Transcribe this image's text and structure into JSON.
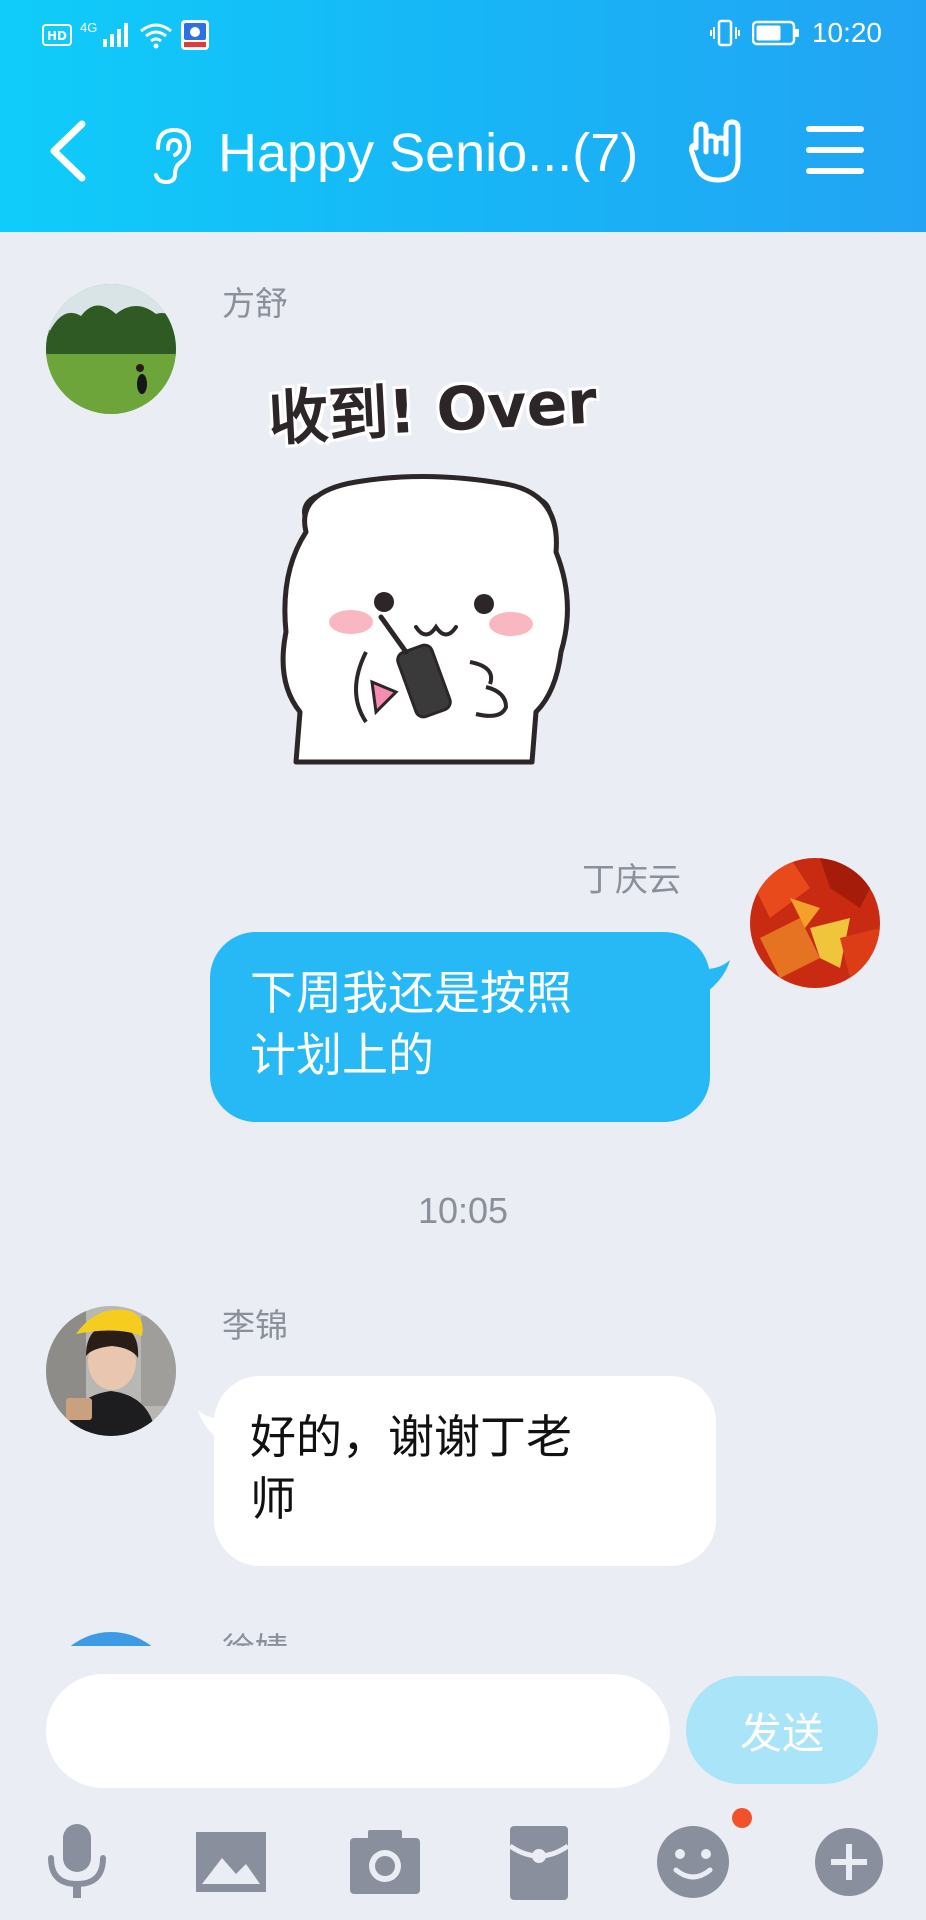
{
  "status_bar": {
    "network_label": "4G",
    "time": "10:20"
  },
  "header": {
    "title": "Happy Senio...(7)"
  },
  "messages": [
    {
      "sender": "方舒",
      "kind": "sticker",
      "sticker_text": "收到! Over"
    },
    {
      "sender": "丁庆云",
      "kind": "text",
      "outgoing": true,
      "lines": [
        "下周我还是按照",
        "计划上的"
      ]
    },
    {
      "kind": "timestamp",
      "time": "10:05"
    },
    {
      "sender": "李锦",
      "kind": "text",
      "outgoing": false,
      "lines": [
        "好的，谢谢丁老",
        "师"
      ]
    },
    {
      "sender": "徐婧",
      "kind": "partial"
    }
  ],
  "input": {
    "value": "",
    "send_label": "发送"
  },
  "toolbar": {
    "icons": [
      "microphone-icon",
      "image-icon",
      "camera-icon",
      "red-packet-icon",
      "emoji-icon",
      "plus-icon"
    ],
    "emoji_has_badge": true
  },
  "colors": {
    "header_gradient_start": "#0fcdfa",
    "header_gradient_end": "#22a4f4",
    "outgoing_bubble": "#27b9f6",
    "incoming_bubble": "#ffffff",
    "background": "#eaedf4",
    "send_button": "#aae4f8",
    "badge": "#f2522b",
    "icon_gray": "#8a8f9e"
  }
}
